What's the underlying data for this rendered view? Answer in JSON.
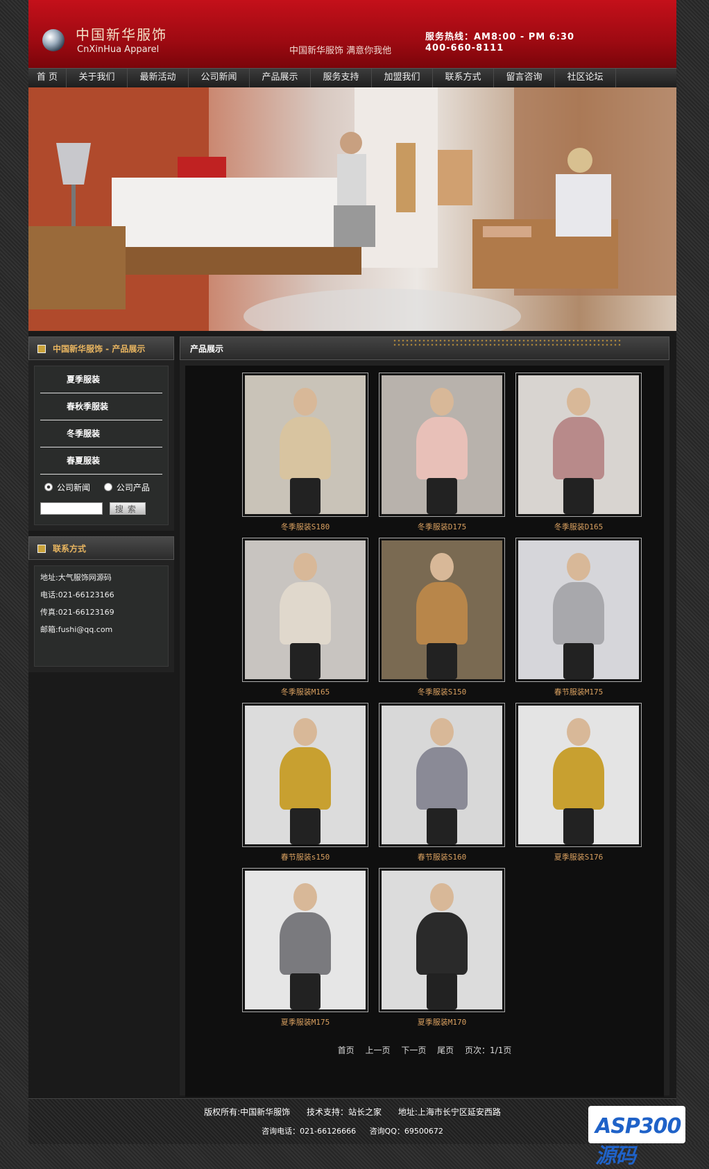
{
  "header": {
    "logo_cn": "中国新华服饰",
    "logo_en": "CnXinHua Apparel",
    "slogan": "中国新华服饰  满意你我他",
    "hotline": "服务热线：AM8:00 - PM 6:30",
    "phone": "400-660-8111"
  },
  "nav": [
    "首 页",
    "关于我们",
    "最新活动",
    "公司新闻",
    "产品展示",
    "服务支持",
    "加盟我们",
    "联系方式",
    "留言咨询",
    "社区论坛"
  ],
  "sidebar": {
    "title": "中国新华服饰 - 产品展示",
    "categories": [
      "夏季服装",
      "春秋季服装",
      "冬季服装",
      "春夏服装"
    ],
    "radios": [
      "公司新闻",
      "公司产品"
    ],
    "search_button": "搜索",
    "contact_title": "联系方式",
    "contact": [
      "地址:大气服饰网源码",
      "电话:021-66123166",
      "传真:021-66123169",
      "邮箱:fushi@qq.com"
    ]
  },
  "main": {
    "title": "产品展示",
    "products": [
      {
        "name": "冬季服装S180"
      },
      {
        "name": "冬季服装D175"
      },
      {
        "name": "冬季服装D165"
      },
      {
        "name": "冬季服装M165"
      },
      {
        "name": "冬季服装S150"
      },
      {
        "name": "春节服装M175"
      },
      {
        "name": "春节服装s150"
      },
      {
        "name": "春节服装S160"
      },
      {
        "name": "夏季服装S176"
      },
      {
        "name": "夏季服装M175"
      },
      {
        "name": "夏季服装M170"
      }
    ],
    "pager": [
      "首页",
      "上一页",
      "下一页",
      "尾页",
      "页次：1/1页"
    ]
  },
  "footer": {
    "line1": [
      "版权所有:中国新华服饰",
      "技术支持：站长之家",
      "地址:上海市长宁区延安西路"
    ],
    "line2": [
      "咨询电话：021-66126666",
      "咨询QQ：69500672"
    ]
  },
  "watermark": "ASP300源码"
}
